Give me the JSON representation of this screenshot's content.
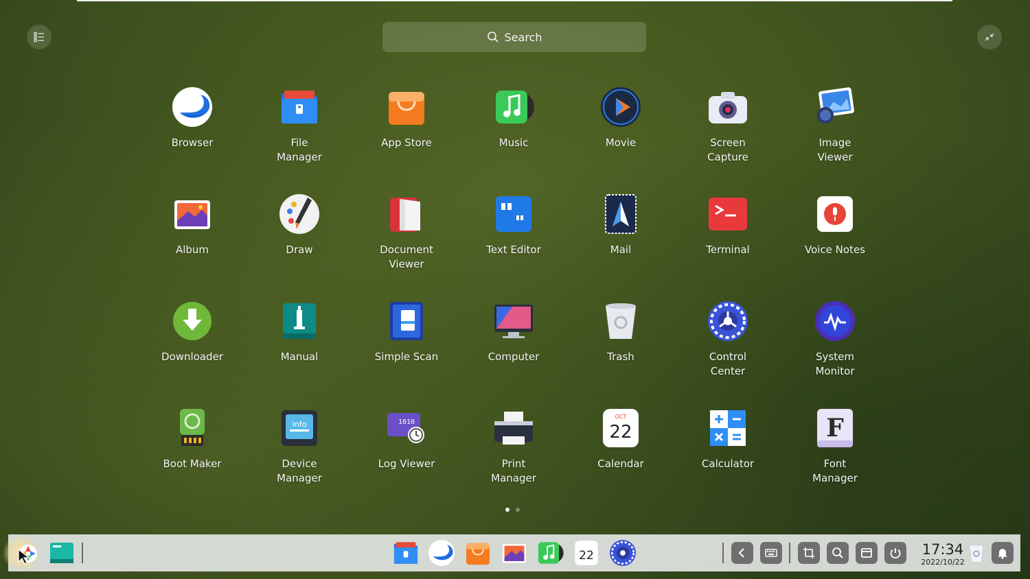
{
  "search": {
    "label": "Search"
  },
  "apps": [
    {
      "name": "Browser",
      "icon": "browser-icon"
    },
    {
      "name": "File\nManager",
      "icon": "file-manager-icon"
    },
    {
      "name": "App Store",
      "icon": "app-store-icon"
    },
    {
      "name": "Music",
      "icon": "music-icon"
    },
    {
      "name": "Movie",
      "icon": "movie-icon"
    },
    {
      "name": "Screen\nCapture",
      "icon": "screen-capture-icon"
    },
    {
      "name": "Image\nViewer",
      "icon": "image-viewer-icon"
    },
    {
      "name": "Album",
      "icon": "album-icon"
    },
    {
      "name": "Draw",
      "icon": "draw-icon"
    },
    {
      "name": "Document\nViewer",
      "icon": "document-viewer-icon"
    },
    {
      "name": "Text Editor",
      "icon": "text-editor-icon"
    },
    {
      "name": "Mail",
      "icon": "mail-icon"
    },
    {
      "name": "Terminal",
      "icon": "terminal-icon"
    },
    {
      "name": "Voice Notes",
      "icon": "voice-notes-icon"
    },
    {
      "name": "Downloader",
      "icon": "downloader-icon"
    },
    {
      "name": "Manual",
      "icon": "manual-icon"
    },
    {
      "name": "Simple Scan",
      "icon": "simple-scan-icon"
    },
    {
      "name": "Computer",
      "icon": "computer-icon"
    },
    {
      "name": "Trash",
      "icon": "trash-icon"
    },
    {
      "name": "Control\nCenter",
      "icon": "control-center-icon"
    },
    {
      "name": "System\nMonitor",
      "icon": "system-monitor-icon"
    },
    {
      "name": "Boot Maker",
      "icon": "boot-maker-icon"
    },
    {
      "name": "Device\nManager",
      "icon": "device-manager-icon"
    },
    {
      "name": "Log Viewer",
      "icon": "log-viewer-icon"
    },
    {
      "name": "Print\nManager",
      "icon": "print-manager-icon"
    },
    {
      "name": "Calendar",
      "icon": "calendar-icon"
    },
    {
      "name": "Calculator",
      "icon": "calculator-icon"
    },
    {
      "name": "Font\nManager",
      "icon": "font-manager-icon"
    }
  ],
  "icon_text": {
    "mail": "",
    "calendar_month": "OCT",
    "calendar_day": "22",
    "log_bits": "1010",
    "device_info": "info",
    "font_letter": "F"
  },
  "pager": {
    "pages": 2,
    "current": 1
  },
  "dock": {
    "clock_time": "17:34",
    "clock_date": "2022/10/22",
    "calendar_day": "22"
  },
  "colors": {
    "accent": "#2a7de1",
    "dock_bg": "#e1e4e1",
    "tray_btn": "#6f6f6f"
  }
}
